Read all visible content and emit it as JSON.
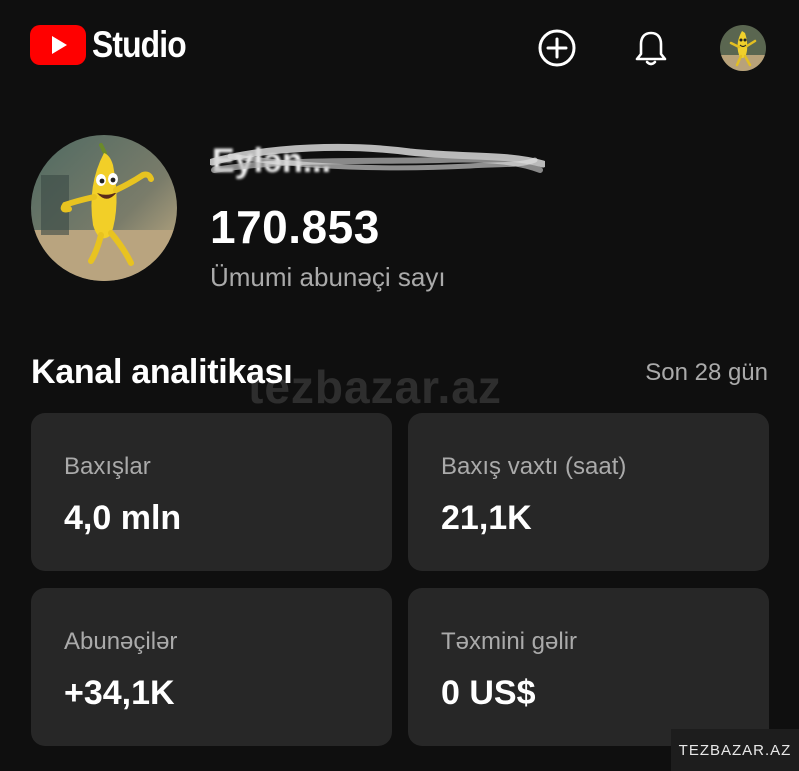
{
  "header": {
    "logo_text": "Studio",
    "icons": [
      "youtube-logo-icon",
      "create-plus-icon",
      "bell-icon",
      "avatar"
    ]
  },
  "channel": {
    "name": "Eylən...",
    "subscriber_count": "170.853",
    "subscriber_label": "Ümumi abunəçi sayı"
  },
  "analytics": {
    "title": "Kanal analitikası",
    "period": "Son 28 gün",
    "cards": [
      {
        "label": "Baxışlar",
        "value": "4,0 mln"
      },
      {
        "label": "Baxış vaxtı (saat)",
        "value": "21,1K"
      },
      {
        "label": "Abunəçilər",
        "value": "+34,1K"
      },
      {
        "label": "Təxmini gəlir",
        "value": "0 US$"
      }
    ]
  },
  "watermark": {
    "center": "tezbazar.az",
    "corner": "TEZBAZAR.AZ"
  },
  "colors": {
    "background": "#0f0f0f",
    "card": "#272727",
    "brand_red": "#ff0000",
    "secondary_text": "#aaaaaa"
  }
}
